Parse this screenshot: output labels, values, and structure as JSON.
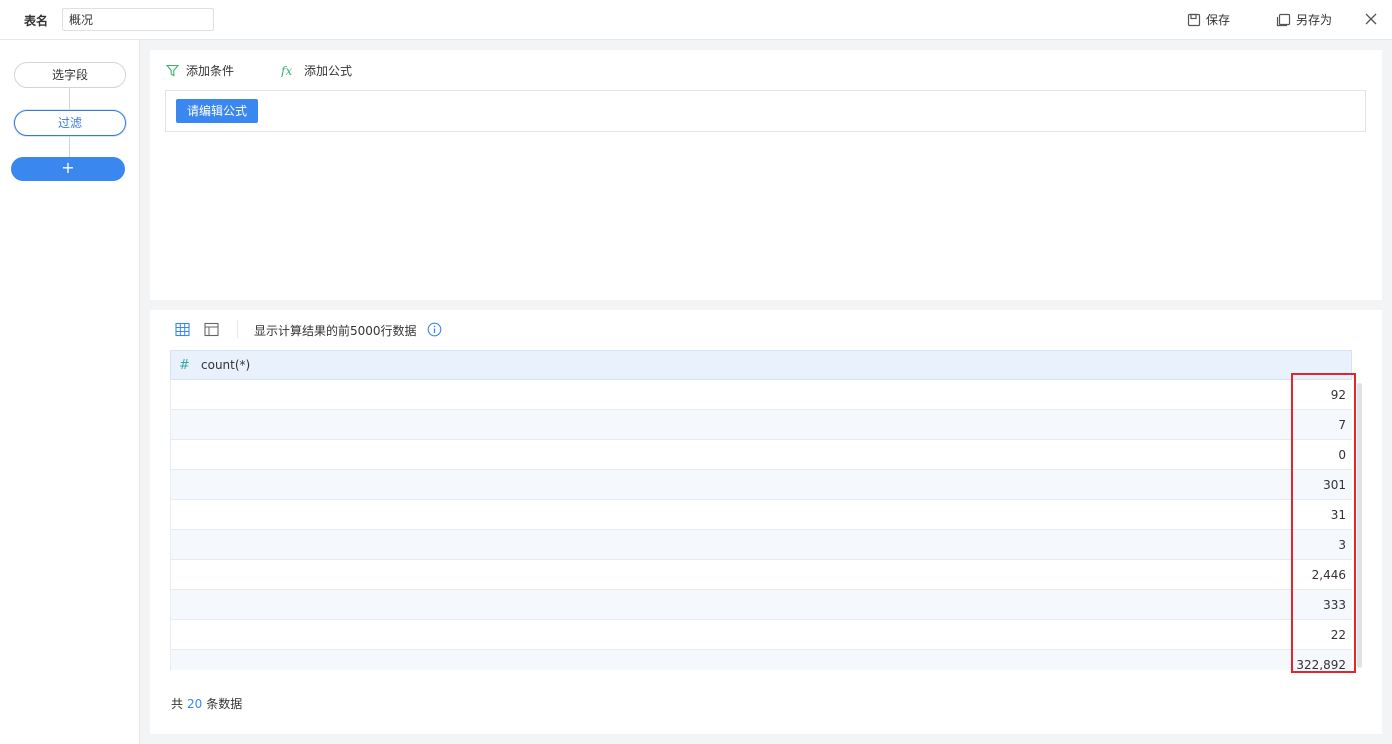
{
  "topbar": {
    "table_name_label": "表名",
    "table_name_value": "概况",
    "save_label": "保存",
    "save_as_label": "另存为"
  },
  "steps": {
    "select_fields": "选字段",
    "filter": "过滤",
    "add": "+"
  },
  "formula": {
    "add_condition": "添加条件",
    "add_formula": "添加公式",
    "edit_formula": "请编辑公式"
  },
  "result": {
    "notice": "显示计算结果的前5000行数据",
    "column_type_icon": "#",
    "column_name": "count(*)",
    "rows": [
      "92",
      "7",
      "0",
      "301",
      "31",
      "3",
      "2,446",
      "333",
      "22",
      "322,892"
    ],
    "total_prefix": "共",
    "total_count": "20",
    "total_suffix": "条数据"
  },
  "colors": {
    "accent": "#3a87f0",
    "highlight": "#e6242c",
    "header_bg": "#e8f1fc"
  }
}
